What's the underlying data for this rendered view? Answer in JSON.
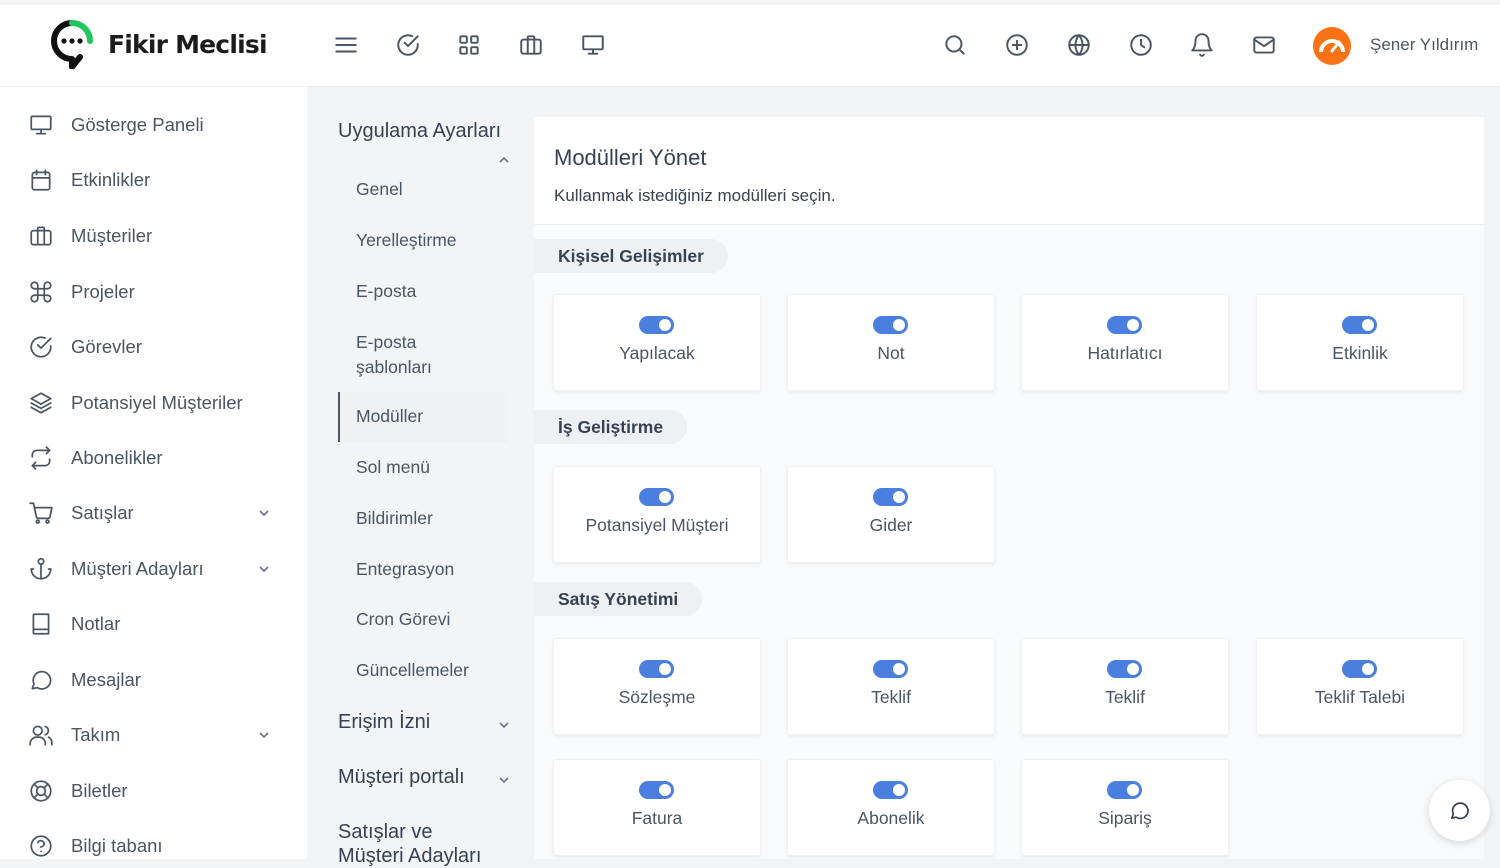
{
  "app": {
    "title": "Fikir Meclisi"
  },
  "header": {
    "icons": [
      "menu-icon",
      "check-circle-icon",
      "grid-icon",
      "briefcase-icon",
      "monitor-icon",
      "search-icon",
      "plus-circle-icon",
      "globe-icon",
      "clock-icon",
      "bell-icon",
      "mail-icon"
    ],
    "user_name": "Şener Yıldırım"
  },
  "sidebar": {
    "items": [
      {
        "label": "Gösterge Paneli",
        "icon": "monitor-icon"
      },
      {
        "label": "Etkinlikler",
        "icon": "calendar-icon"
      },
      {
        "label": "Müşteriler",
        "icon": "briefcase-icon"
      },
      {
        "label": "Projeler",
        "icon": "command-icon"
      },
      {
        "label": "Görevler",
        "icon": "check-circle-icon"
      },
      {
        "label": "Potansiyel Müşteriler",
        "icon": "layers-icon"
      },
      {
        "label": "Abonelikler",
        "icon": "repeat-icon"
      },
      {
        "label": "Satışlar",
        "icon": "cart-icon",
        "has_submenu": true
      },
      {
        "label": "Müşteri Adayları",
        "icon": "anchor-icon",
        "has_submenu": true
      },
      {
        "label": "Notlar",
        "icon": "book-icon"
      },
      {
        "label": "Mesajlar",
        "icon": "message-icon"
      },
      {
        "label": "Takım",
        "icon": "users-icon",
        "has_submenu": true
      },
      {
        "label": "Biletler",
        "icon": "lifebuoy-icon"
      },
      {
        "label": "Bilgi tabanı",
        "icon": "help-circle-icon"
      }
    ]
  },
  "settings_nav": {
    "app_settings": "Uygulama Ayarları",
    "items": [
      "Genel",
      "Yerelleştirme",
      "E-posta",
      "E-posta şablonları",
      "Modüller",
      "Sol menü",
      "Bildirimler",
      "Entegrasyon",
      "Cron Görevi",
      "Güncellemeler"
    ],
    "active": "Modüller",
    "access": "Erişim İzni",
    "client_portal": "Müşteri portalı",
    "sales_leads": "Satışlar ve Müşteri Adayları"
  },
  "main": {
    "title": "Modülleri Yönet",
    "subtitle": "Kullanmak istediğiniz modülleri seçin.",
    "sections": [
      {
        "name": "Kişisel Gelişimler",
        "modules": [
          {
            "label": "Yapılacak",
            "enabled": true
          },
          {
            "label": "Not",
            "enabled": true
          },
          {
            "label": "Hatırlatıcı",
            "enabled": true
          },
          {
            "label": "Etkinlik",
            "enabled": true
          }
        ]
      },
      {
        "name": "İş Geliştirme",
        "modules": [
          {
            "label": "Potansiyel Müşteri",
            "enabled": true
          },
          {
            "label": "Gider",
            "enabled": true
          }
        ]
      },
      {
        "name": "Satış Yönetimi",
        "modules": [
          {
            "label": "Sözleşme",
            "enabled": true
          },
          {
            "label": "Teklif",
            "enabled": true
          },
          {
            "label": "Teklif",
            "enabled": true
          },
          {
            "label": "Teklif Talebi",
            "enabled": true
          },
          {
            "label": "Fatura",
            "enabled": true
          },
          {
            "label": "Abonelik",
            "enabled": true
          },
          {
            "label": "Sipariş",
            "enabled": true
          }
        ]
      }
    ]
  },
  "colors": {
    "toggle_on": "#4a7fe0",
    "avatar": "#f97316",
    "text": "#4b5563"
  }
}
